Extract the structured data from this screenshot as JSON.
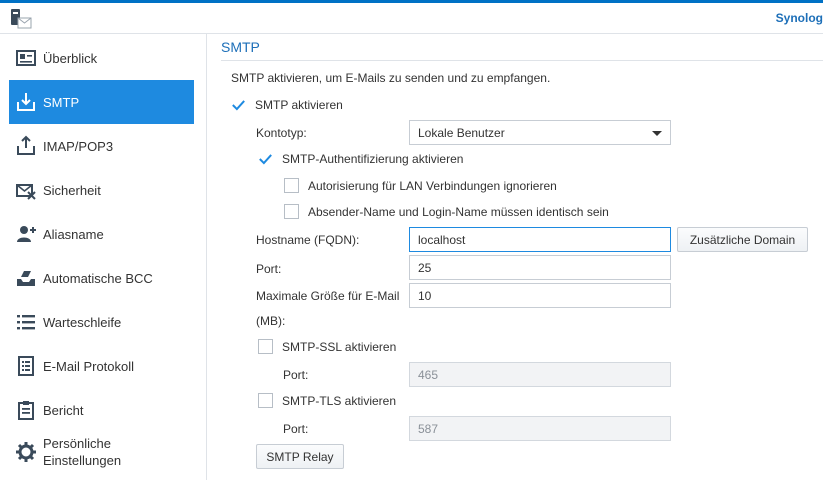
{
  "header": {
    "brand": "Synolog"
  },
  "sidebar": {
    "items": [
      {
        "label": "Überblick",
        "icon": "overview-icon"
      },
      {
        "label": "SMTP",
        "icon": "smtp-icon",
        "active": true
      },
      {
        "label": "IMAP/POP3",
        "icon": "imap-icon"
      },
      {
        "label": "Sicherheit",
        "icon": "security-icon"
      },
      {
        "label": "Aliasname",
        "icon": "alias-icon"
      },
      {
        "label": "Automatische BCC",
        "icon": "bcc-icon"
      },
      {
        "label": "Warteschleife",
        "icon": "queue-icon"
      },
      {
        "label": "E-Mail Protokoll",
        "icon": "log-icon"
      },
      {
        "label": "Bericht",
        "icon": "report-icon"
      },
      {
        "label_line1": "Persönliche",
        "label_line2": "Einstellungen",
        "icon": "gear-icon"
      }
    ]
  },
  "main": {
    "title": "SMTP",
    "description": "SMTP aktivieren, um E-Mails zu senden und zu empfangen.",
    "enable_smtp": {
      "label": "SMTP aktivieren",
      "checked": true
    },
    "account_type": {
      "label": "Kontotyp:",
      "value": "Lokale Benutzer"
    },
    "smtp_auth": {
      "label": "SMTP-Authentifizierung aktivieren",
      "checked": true
    },
    "ignore_lan_auth": {
      "label": "Autorisierung für LAN Verbindungen ignorieren",
      "checked": false
    },
    "sender_login_same": {
      "label": "Absender-Name und Login-Name müssen identisch sein",
      "checked": false
    },
    "hostname": {
      "label": "Hostname (FQDN):",
      "value": "localhost"
    },
    "extra_domain_button": "Zusätzliche Domain",
    "port": {
      "label": "Port:",
      "value": "25"
    },
    "max_size": {
      "label_line1": "Maximale Größe für E-Mail",
      "label_line2": "(MB):",
      "value": "10"
    },
    "smtp_ssl": {
      "label": "SMTP-SSL aktivieren",
      "checked": false,
      "port_label": "Port:",
      "port_value": "465"
    },
    "smtp_tls": {
      "label": "SMTP-TLS aktivieren",
      "checked": false,
      "port_label": "Port:",
      "port_value": "587"
    },
    "relay_button": "SMTP Relay"
  },
  "colors": {
    "accent": "#1e8ae0",
    "title": "#1d6fb8"
  }
}
